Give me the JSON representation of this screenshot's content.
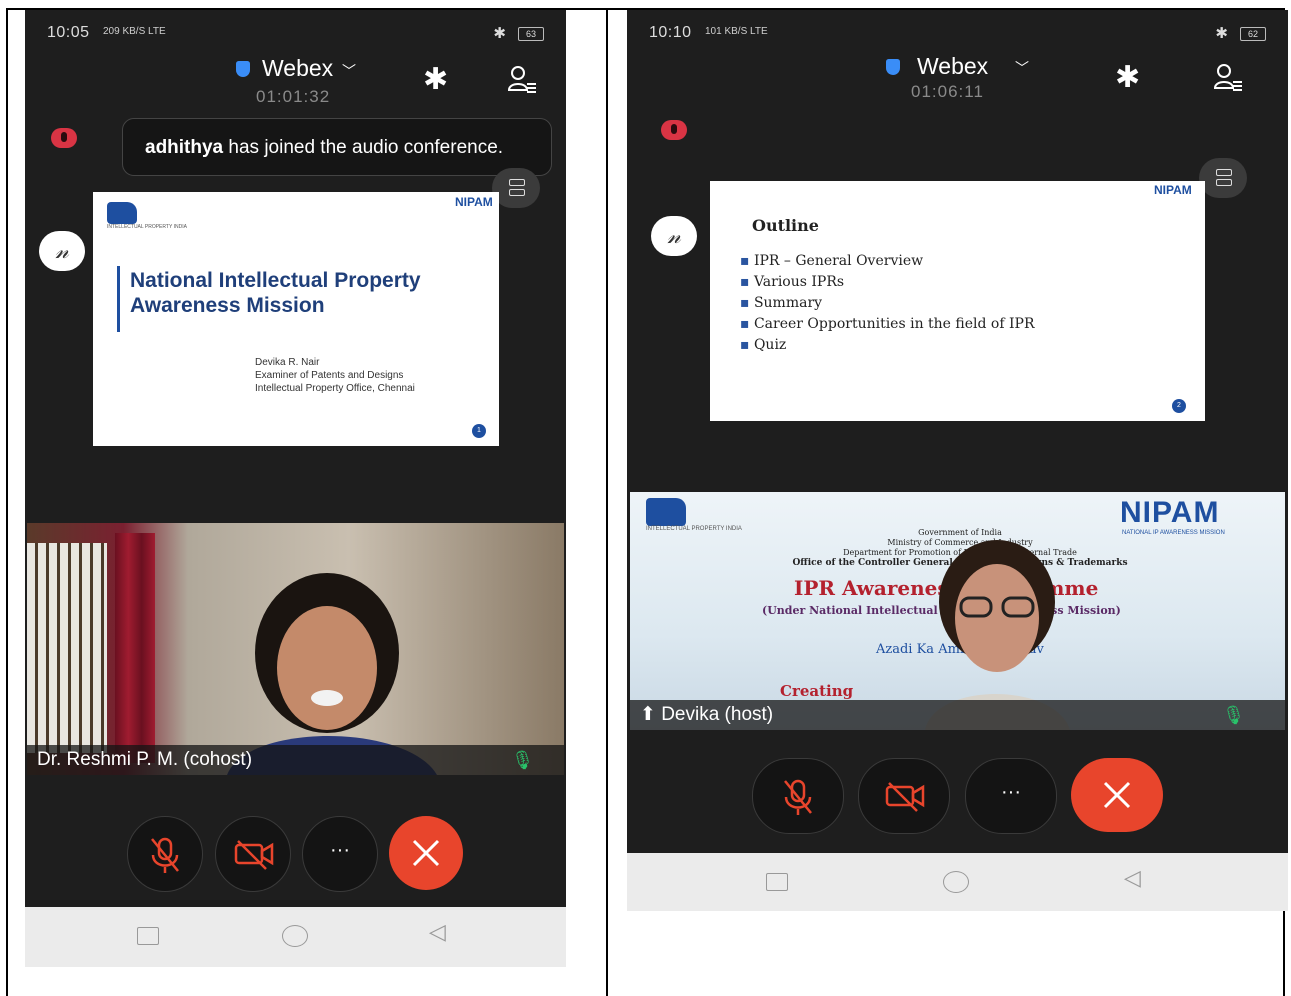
{
  "left_phone": {
    "status": {
      "time": "10:05",
      "signal_info": "209 KB/S LTE",
      "battery": "63"
    },
    "app": {
      "name": "Webex",
      "elapsed": "01:01:32"
    },
    "toast": {
      "user": "adhithya",
      "message": "has joined the audio conference."
    },
    "slide": {
      "logo_text": "INTELLECTUAL PROPERTY INDIA",
      "corner_logo": "NIPAM",
      "title_line1": "National Intellectual Property",
      "title_line2": "Awareness Mission",
      "presenter_name": "Devika R. Nair",
      "presenter_role": "Examiner of Patents and Designs",
      "presenter_office": "Intellectual Property Office, Chennai",
      "page": "1"
    },
    "video": {
      "name": "Dr. Reshmi P. M. (cohost)"
    }
  },
  "right_phone": {
    "status": {
      "time": "10:10",
      "signal_info": "101 KB/S LTE",
      "battery": "62"
    },
    "app": {
      "name": "Webex",
      "elapsed": "01:06:11"
    },
    "slide": {
      "corner_logo": "NIPAM",
      "heading": "Outline",
      "items": [
        "IPR – General Overview",
        "Various IPRs",
        "Summary",
        "Career Opportunities in the field of IPR",
        "Quiz"
      ],
      "page": "2"
    },
    "share": {
      "logo_text": "INTELLECTUAL PROPERTY INDIA",
      "gov": "Government of India",
      "ministry": "Ministry of Commerce and Industry",
      "dept": "Department for Promotion of Industry and Internal Trade",
      "office": "Office of the Controller General of Patents, Designs & Trademarks",
      "headline": "IPR Awareness Programme",
      "subline": "(Under National Intellectual Property Awareness Mission)",
      "azadi": "Azadi Ka Amrit Mahotsav",
      "creating": "Creating",
      "nipam": "NIPAM",
      "nipam_tag": "NATIONAL IP AWARENESS MISSION"
    },
    "video": {
      "name": "Devika (host)"
    }
  }
}
